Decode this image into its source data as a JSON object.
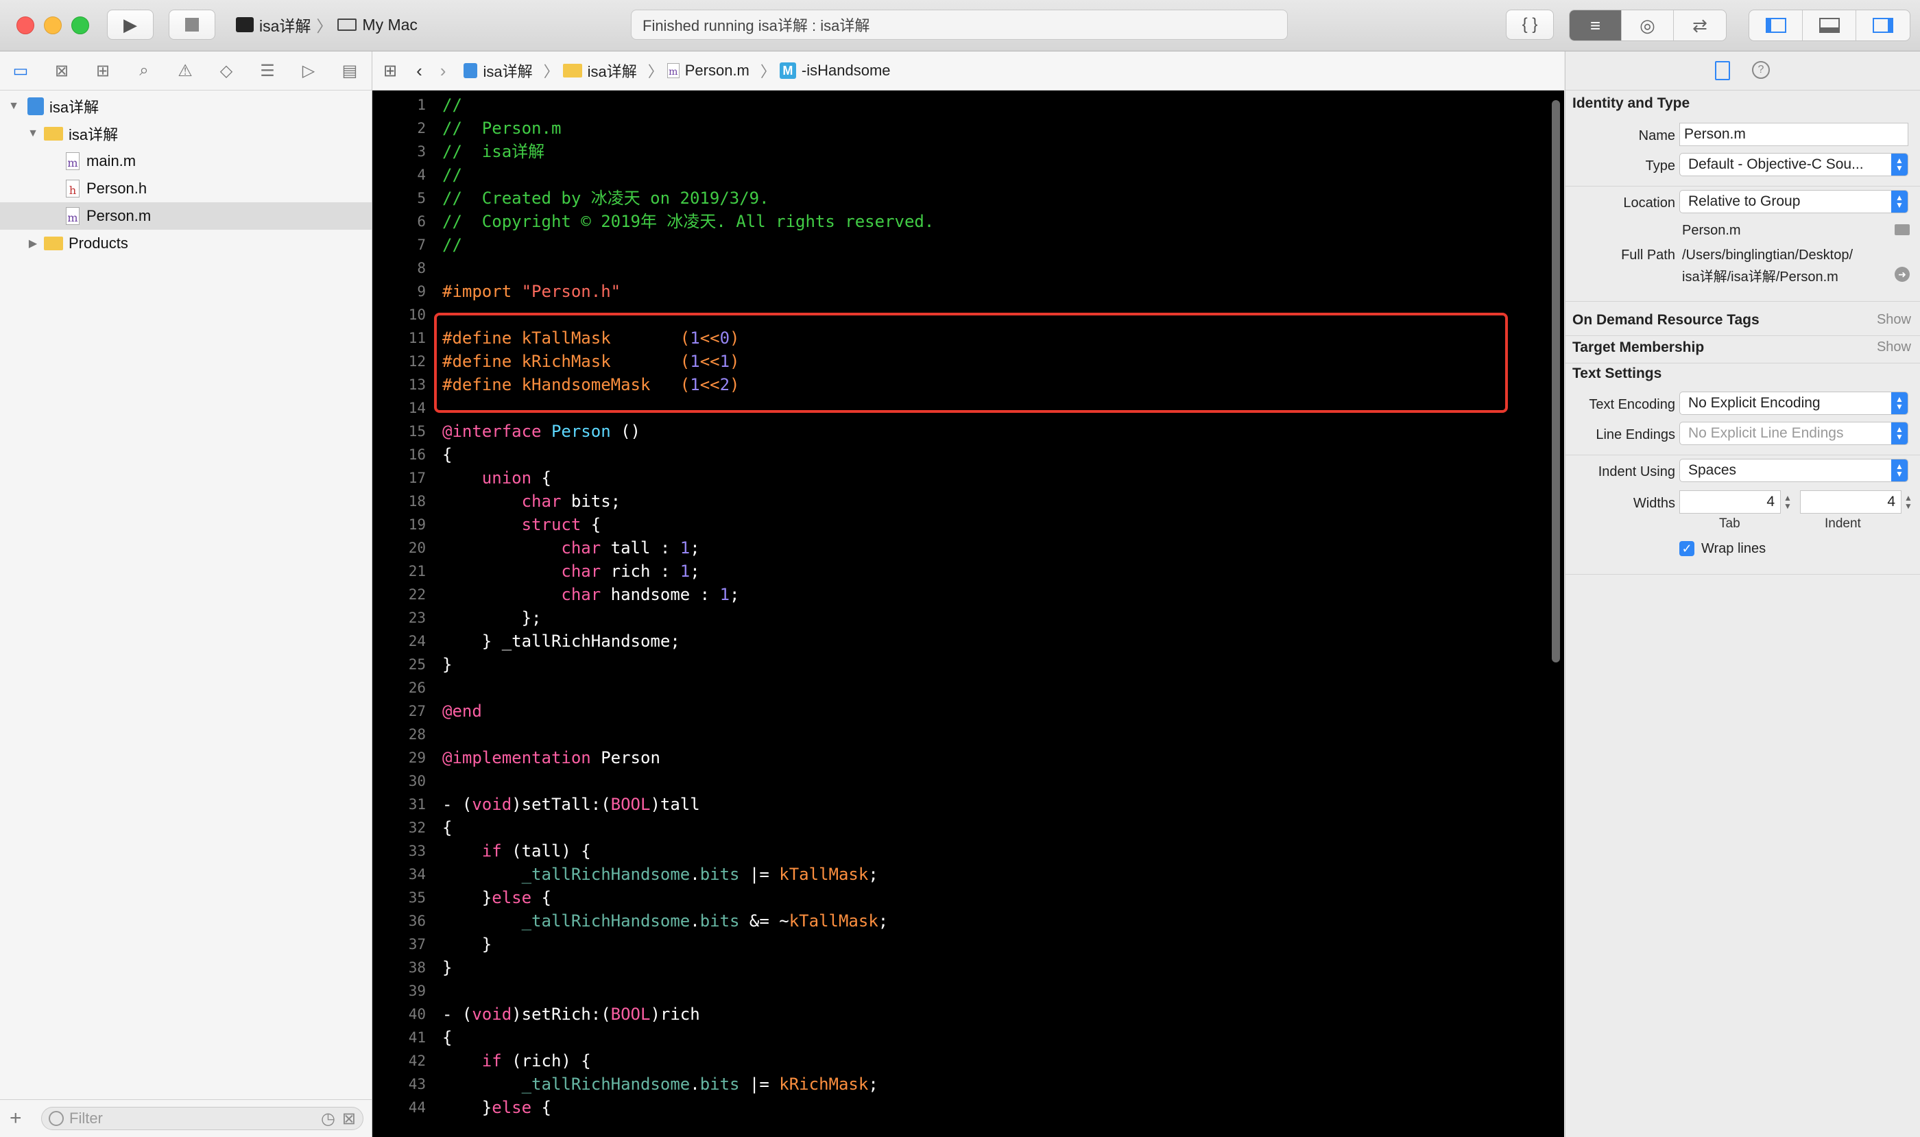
{
  "toolbar": {
    "scheme_target": "isa详解",
    "scheme_device": "My Mac",
    "activity_text": "Finished running isa详解 : isa详解",
    "braces_label": "{ }"
  },
  "navigator": {
    "tree": [
      {
        "label": "isa详解",
        "kind": "project",
        "level": 0,
        "expanded": true
      },
      {
        "label": "isa详解",
        "kind": "folder",
        "level": 1,
        "expanded": true
      },
      {
        "label": "main.m",
        "kind": "m-file",
        "level": 2
      },
      {
        "label": "Person.h",
        "kind": "h-file",
        "level": 2
      },
      {
        "label": "Person.m",
        "kind": "m-file",
        "level": 2,
        "selected": true
      },
      {
        "label": "Products",
        "kind": "folder",
        "level": 1,
        "expanded": false
      }
    ],
    "filter_placeholder": "Filter"
  },
  "jumpbar": {
    "crumbs": [
      "isa详解",
      "isa详解",
      "Person.m",
      "-isHandsome"
    ]
  },
  "editor": {
    "line_numbers": [
      "1",
      "2",
      "3",
      "4",
      "5",
      "6",
      "7",
      "8",
      "9",
      "10",
      "11",
      "12",
      "13",
      "14",
      "15",
      "16",
      "17",
      "18",
      "19",
      "20",
      "21",
      "22",
      "23",
      "24",
      "25",
      "26",
      "27",
      "28",
      "29",
      "30",
      "31",
      "32",
      "33",
      "34",
      "35",
      "36",
      "37",
      "38",
      "39",
      "40",
      "41",
      "42",
      "43",
      "44"
    ],
    "code": {
      "l1": "//",
      "l2": "//  Person.m",
      "l3": "//  isa详解",
      "l4": "//",
      "l5": "//  Created by 冰凌天 on 2019/3/9.",
      "l6": "//  Copyright © 2019年 冰凌天. All rights reserved.",
      "l7": "//",
      "l9_a": "#import ",
      "l9_b": "\"Person.h\"",
      "l11_a": "#define kTallMask       ",
      "l11_b": "(",
      "l11_c": "1",
      "l11_d": "<<",
      "l11_e": "0",
      "l11_f": ")",
      "l12_a": "#define kRichMask       ",
      "l12_c": "1",
      "l12_e": "1",
      "l13_a": "#define kHandsomeMask   ",
      "l13_c": "1",
      "l13_e": "2",
      "l15_a": "@interface",
      "l15_b": " ",
      "l15_c": "Person",
      "l15_d": " ()",
      "l16": "{",
      "l17_a": "    union",
      "l17_b": " {",
      "l18_a": "        char",
      "l18_b": " bits;",
      "l19_a": "        struct",
      "l19_b": " {",
      "l20_a": "            char",
      "l20_b": " tall : ",
      "l20_c": "1",
      "l20_d": ";",
      "l21_a": "            char",
      "l21_b": " rich : ",
      "l21_c": "1",
      "l21_d": ";",
      "l22_a": "            char",
      "l22_b": " handsome : ",
      "l22_c": "1",
      "l22_d": ";",
      "l23": "        };",
      "l24": "    } _tallRichHandsome;",
      "l25": "}",
      "l27": "@end",
      "l29_a": "@implementation",
      "l29_b": " Person",
      "l31_a": "- (",
      "l31_b": "void",
      "l31_c": ")setTall:(",
      "l31_d": "BOOL",
      "l31_e": ")tall",
      "l32": "{",
      "l33_a": "    if",
      "l33_b": " (tall) {",
      "l34_a": "        _tallRichHandsome",
      "l34_b": ".",
      "l34_c": "bits",
      "l34_d": " |= ",
      "l34_e": "kTallMask",
      "l34_f": ";",
      "l35_a": "    }",
      "l35_b": "else",
      "l35_c": " {",
      "l36_a": "        _tallRichHandsome",
      "l36_b": ".",
      "l36_c": "bits",
      "l36_d": " &= ~",
      "l36_e": "kTallMask",
      "l36_f": ";",
      "l37": "    }",
      "l38": "}",
      "l40_a": "- (",
      "l40_b": "void",
      "l40_c": ")setRich:(",
      "l40_d": "BOOL",
      "l40_e": ")rich",
      "l41": "{",
      "l42_a": "    if",
      "l42_b": " (rich) {",
      "l43_a": "        _tallRichHandsome",
      "l43_b": ".",
      "l43_c": "bits",
      "l43_d": " |= ",
      "l43_e": "kRichMask",
      "l43_f": ";",
      "l44_a": "    }",
      "l44_b": "else",
      "l44_c": " {"
    }
  },
  "inspector": {
    "identity_title": "Identity and Type",
    "name_label": "Name",
    "name_value": "Person.m",
    "type_label": "Type",
    "type_value": "Default - Objective-C Sou...",
    "location_label": "Location",
    "location_value": "Relative to Group",
    "location_file": "Person.m",
    "fullpath_label": "Full Path",
    "fullpath_line1": "/Users/binglingtian/Desktop/",
    "fullpath_line2": "isa详解/isa详解/Person.m",
    "odr_title": "On Demand Resource Tags",
    "odr_show": "Show",
    "target_title": "Target Membership",
    "target_show": "Show",
    "text_settings_title": "Text Settings",
    "encoding_label": "Text Encoding",
    "encoding_value": "No Explicit Encoding",
    "line_endings_label": "Line Endings",
    "line_endings_value": "No Explicit Line Endings",
    "indent_label": "Indent Using",
    "indent_value": "Spaces",
    "widths_label": "Widths",
    "tab_width": "4",
    "indent_width": "4",
    "tab_caption": "Tab",
    "indent_caption": "Indent",
    "wrap_label": "Wrap lines"
  },
  "colors": {
    "editor_bg": "#000000",
    "comment": "#41cc45",
    "preprocessor": "#fd8f3f",
    "keyword": "#fc5fa3",
    "highlight_box": "#e8392d",
    "accent": "#2f86f6"
  }
}
